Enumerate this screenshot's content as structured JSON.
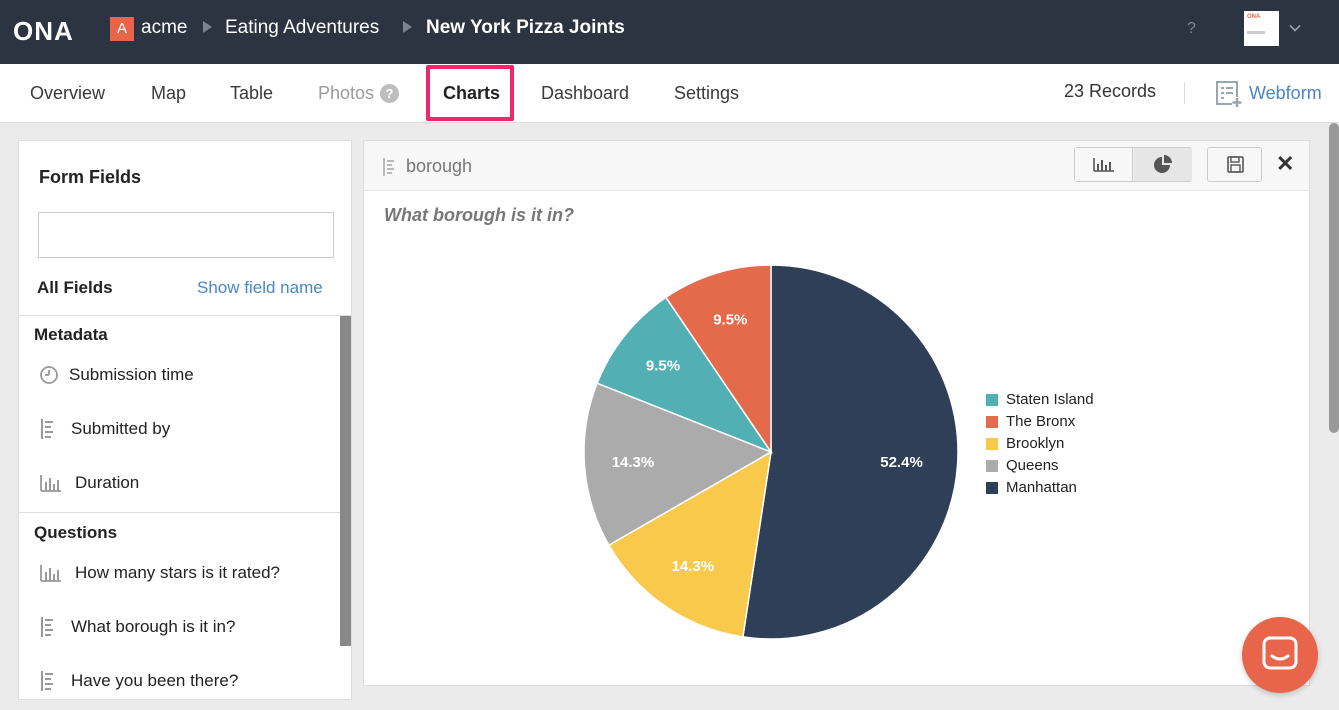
{
  "topbar": {
    "logo": "ONA",
    "org_badge": "A",
    "breadcrumb": [
      "acme",
      "Eating Adventures",
      "New York Pizza Joints"
    ],
    "help": "?",
    "avatar_text": "ONA"
  },
  "nav": {
    "tabs": [
      {
        "label": "Overview"
      },
      {
        "label": "Map"
      },
      {
        "label": "Table"
      },
      {
        "label": "Photos"
      },
      {
        "label": "Charts"
      },
      {
        "label": "Dashboard"
      },
      {
        "label": "Settings"
      }
    ],
    "photos_help": "?",
    "records": "23 Records",
    "webform": "Webform"
  },
  "left": {
    "title": "Form Fields",
    "search_placeholder": "",
    "all_fields": "All Fields",
    "show_field_name": "Show field name",
    "metadata": {
      "label": "Metadata",
      "items": [
        "Submission time",
        "Submitted by",
        "Duration"
      ]
    },
    "questions": {
      "label": "Questions",
      "items": [
        "How many stars is it rated?",
        "What borough is it in?",
        "Have you been there?"
      ]
    }
  },
  "card": {
    "field": "borough",
    "question": "What borough is it in?"
  },
  "chart_data": {
    "type": "pie",
    "categories": [
      "Staten Island",
      "The Bronx",
      "Brooklyn",
      "Queens",
      "Manhattan"
    ],
    "values": [
      9.5,
      9.5,
      14.3,
      14.3,
      52.4
    ],
    "labels": [
      "9.5%",
      "9.5%",
      "14.3%",
      "14.3%",
      "52.4%"
    ],
    "colors": [
      "#52b0b5",
      "#e5694b",
      "#f8c94a",
      "#ababab",
      "#2e3f57"
    ],
    "legend_position": "right"
  }
}
